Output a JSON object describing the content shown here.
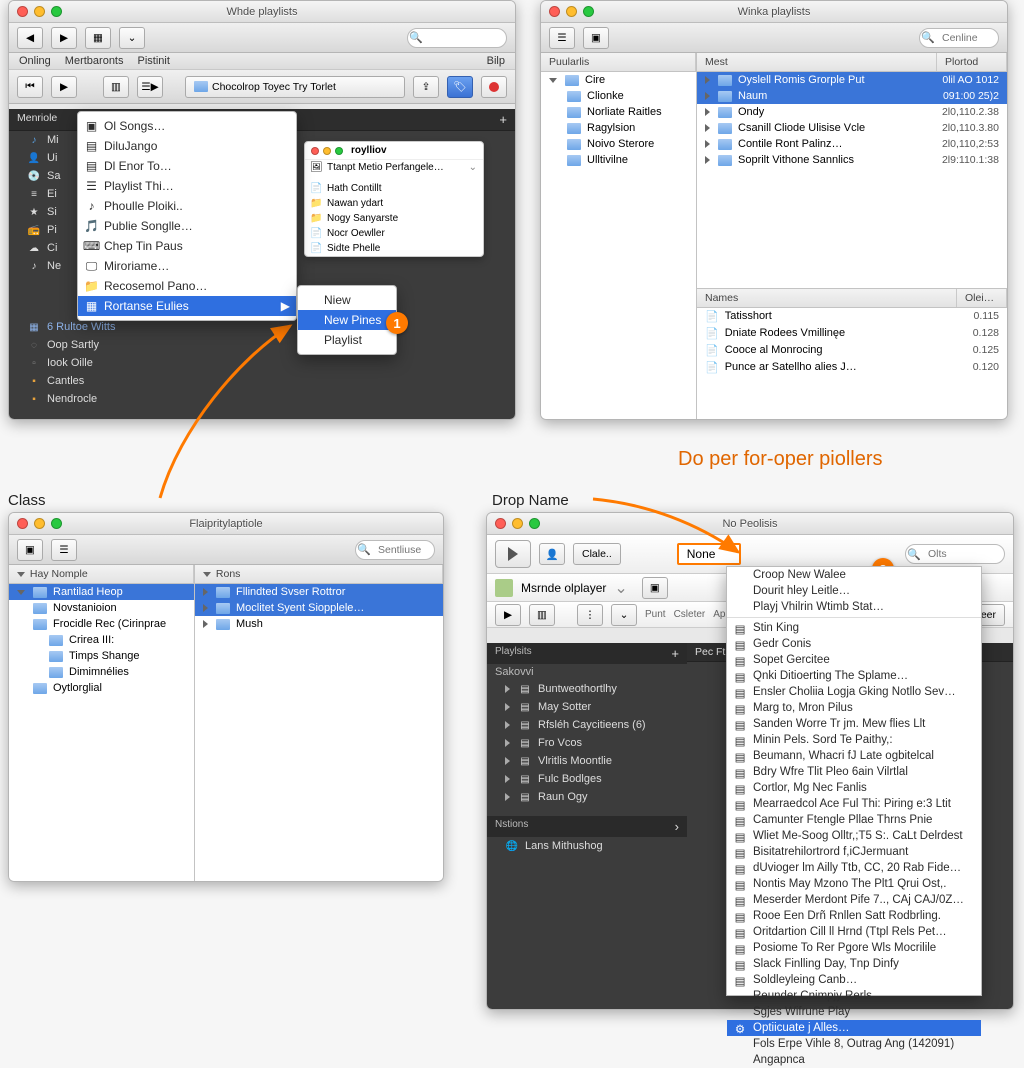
{
  "labels": {
    "class": "Class",
    "drop_name": "Drop Name",
    "do_per": "Do per for-oper piollers"
  },
  "badges": {
    "one": "1",
    "two": "2"
  },
  "win1": {
    "title": "Whde playlists",
    "menubar": {
      "a": "Onling",
      "b": "Mertbaronts",
      "c": "Pistinit",
      "help": "Bilp"
    },
    "search_ph": "",
    "crumb": "Chocolrop Toyec Try Torlet",
    "sidehead_l": "Menriole",
    "sidehead_r": "",
    "sec_plus": "+",
    "side_rows": [
      "Mi",
      "Ui",
      "Sa",
      "Ei",
      "Si",
      "Pi",
      "Ci",
      "Ne"
    ],
    "side2": [
      "6 Rultoe Witts",
      "Oop Sartly",
      "Iook Oille",
      "Cantles",
      "Nendrocle"
    ],
    "ctx_items": [
      "Ol Songs…",
      "DiluJango",
      "Dl Enor To…",
      "Playlist Thi…",
      "Phoulle Ploiki..",
      "Publie Songlle…",
      "Chep Tin Paus",
      "Miroriame…",
      "Recosemol Pano…"
    ],
    "ctx_sel": "Rortanse Eulies",
    "sub_items": [
      "Niew",
      "New Pines",
      "Playlist"
    ],
    "popover": {
      "title": "roylliov",
      "subtitle": "Ttanpt Metio Perfangele…",
      "items": [
        "Hath Contillt",
        "Nawan ydart",
        "Nogy Sanyarste",
        "Nocr Oewller",
        "Sidte Phelle"
      ]
    }
  },
  "win2": {
    "title": "Winka playlists",
    "search_ph": "Cenline",
    "left_head": "Puularlis",
    "left_rows": [
      "Cire",
      "Clionke",
      "Norliate Raitles",
      "Ragylsion",
      "Noivo Sterore",
      "Ulltivilne"
    ],
    "top_head_l": "Mest",
    "top_head_r": "Plortod",
    "top_rows": [
      {
        "t": "Oyslell Romis Grorple Put",
        "d": "0lil AO 1012",
        "sel": true
      },
      {
        "t": "Naum",
        "d": "091:00 25)2",
        "sel": true
      },
      {
        "t": "Ondy",
        "d": "2l0,110.2.38"
      },
      {
        "t": "Csanill Cliode Ulisise Vcle",
        "d": "2l0,110.3.80"
      },
      {
        "t": "Contile Ront Palinz…",
        "d": "2l0,110,2:53"
      },
      {
        "t": "Soprilt Vithone Sannlics",
        "d": "2l9:110.1:38"
      }
    ],
    "bot_head_l": "Names",
    "bot_head_r": "Olei…",
    "bot_rows": [
      {
        "t": "Tatisshort",
        "d": "0.115"
      },
      {
        "t": "Dniate Rodees Vmillinęe",
        "d": "0.128"
      },
      {
        "t": "Cooce al Monrocing",
        "d": "0.125"
      },
      {
        "t": "Punce ar Satellho alies J…",
        "d": "0.120"
      }
    ]
  },
  "win3": {
    "title": "Flaipritylaptiole",
    "search_ph": "Sentliuse",
    "left_head": "Hay Nomple",
    "left_rows": [
      {
        "t": "Rantilad Heop",
        "l": 0,
        "sel": true
      },
      {
        "t": "Novstanioion",
        "l": 1
      },
      {
        "t": "Frocidle Rec (Cirinprae",
        "l": 1
      },
      {
        "t": "Crirea III:",
        "l": 2
      },
      {
        "t": "Timps Shange",
        "l": 2
      },
      {
        "t": "Dimimnélies",
        "l": 2
      },
      {
        "t": "Oytlorglial",
        "l": 1
      }
    ],
    "right_head": "Rons",
    "right_rows": [
      {
        "t": "Fllindted Svser Rottror",
        "sel": true
      },
      {
        "t": "Moclitet Syent Siopplele…",
        "sel": true
      },
      {
        "t": "Mush"
      }
    ]
  },
  "win4": {
    "title": "No Peolisis",
    "search_ph": "Olts",
    "clalebtn": "Clale..",
    "name_value": "None",
    "playerrow": "Msrnde olplayer",
    "subbtns": {
      "a": "Punt",
      "b": "Csleter",
      "c": "Apely",
      "h": "Haleer"
    },
    "cat_pl": "Playlsits",
    "cat_pl_sub": "Sakovvi",
    "side_rows": [
      "Buntweothortlhy",
      "May Sotter",
      "Rfsléh Caycitieens (6)",
      "Fro Vcos",
      "Vlritlis Moontlie",
      "Fulc Bodlges",
      "Raun Ogy"
    ],
    "cat_ns": "Nstions",
    "ns_row": "Lans Mithushog",
    "rpane_head": "Pec   Ftitllos",
    "longmenu": {
      "top": [
        "Croop New Walee",
        "Dourit hley Leitle…",
        "Playj Vhilrin Wtimb Stat…"
      ],
      "items": [
        "Stin King",
        "Gedr Conis",
        "Sopet Gercitee",
        "Qnki Ditioerting The Splame…",
        "Ensler Choliia Logja Gking Notllo Sev…",
        "Marg to, Mron Pilus",
        "Sanden Worre Tr jm. Mew flies Llt",
        "Minin Pels. Sord Te Paithy,:",
        "Beumann, Whacri fJ Late ogbitelcal",
        "Bdry Wfre Tlit Pleo 6ain Vilrtlal",
        "Cortlor, Mg Nec Fanlis",
        "Mearraedcol Ace Ful Thi: Piring e:3 Ltit",
        "Camunter Ftengle Pllae Thrns Pnie",
        "Wliet Me-Soog Olltr,;T5 S:. CaLt Delrdest",
        "Bisitatrehilortrord f,iCJermuant",
        "dUvioger lm Ailly Ttb, CC, 20 Rab Fide…",
        "Nontis May Mzono The Plt1 Qrui Ost,.",
        "Meserder Merdont Pife 7.., CAj CAJ/0Z…",
        "Rooe Een Drñ Rnllen Satt Rodbrling.",
        "Oritdartion Cill ll Hrnd (Ttpl Rels Pet…",
        "Posiome To Rer Pgore Wls Mocrilile",
        "Slack Finlling Day, Tnp Dinfy",
        "Soldleyleing Canb…"
      ],
      "plain": [
        "Reunder Cnimpjy Rerls",
        "Sgjes Wifrune Play"
      ],
      "sel": "Optiicuate j Alles…",
      "tail": [
        "Fols Erpe Vihle 8, Outrag Ang (142091)",
        "Angapnca"
      ]
    }
  }
}
